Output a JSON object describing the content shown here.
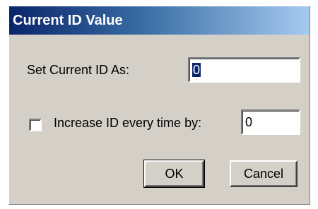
{
  "window": {
    "title": "Current ID Value"
  },
  "current_id": {
    "label": "Set Current ID As:",
    "value": "0"
  },
  "increase": {
    "checked": false,
    "label": "Increase ID every time by:",
    "value": "0"
  },
  "buttons": {
    "ok": "OK",
    "cancel": "Cancel"
  }
}
